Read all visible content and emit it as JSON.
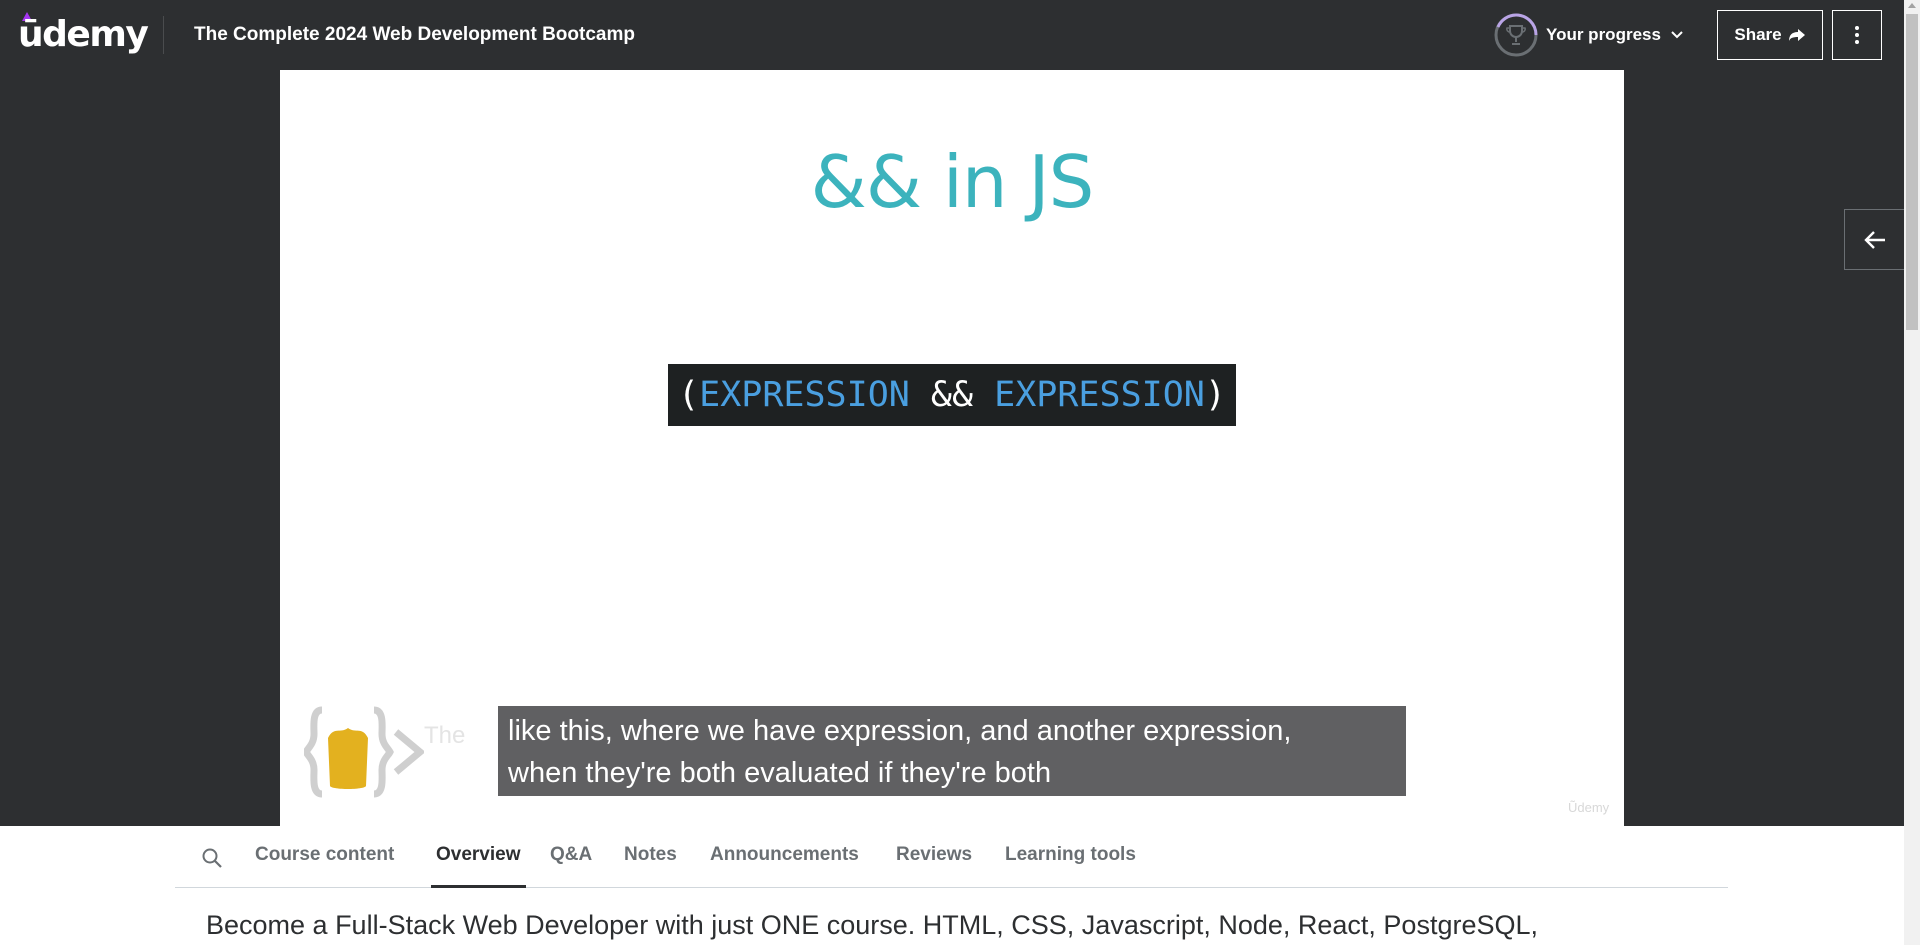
{
  "header": {
    "logo_text": "ūdemy",
    "course_title": "The Complete 2024 Web Development Bootcamp",
    "progress_label": "Your progress",
    "share_label": "Share"
  },
  "icons": {
    "progress": "trophy-icon",
    "progress_toggle": "chevron-down-icon",
    "share": "share-arrow-icon",
    "more": "vertical-dots-icon",
    "collapse": "arrow-left-icon",
    "search": "search-icon"
  },
  "slide": {
    "title": "&& in JS",
    "code": {
      "open_paren": "(",
      "left_expr": "EXPRESSION",
      "operator": " && ",
      "right_expr": "EXPRESSION",
      "close_paren": ")"
    },
    "faint_text": "The",
    "watermark": "Ũdemy"
  },
  "subtitle": {
    "line1": "like this, where we have expression, and another expression,",
    "line2": "when they're both evaluated if they're both"
  },
  "tabs": [
    {
      "label": "Course content"
    },
    {
      "label": "Overview"
    },
    {
      "label": "Q&A"
    },
    {
      "label": "Notes"
    },
    {
      "label": "Announcements"
    },
    {
      "label": "Reviews"
    },
    {
      "label": "Learning tools"
    }
  ],
  "active_tab": "Overview",
  "overview": {
    "text": "Become a Full-Stack Web Developer with just ONE course. HTML, CSS, Javascript, Node, React, PostgreSQL,"
  },
  "colors": {
    "header_bg": "#2d2f31",
    "slide_title": "#3cb3bd",
    "code_keyword": "#4a9fe0",
    "brand_purple": "#a435f0",
    "brand_yellow": "#e3b11f"
  }
}
